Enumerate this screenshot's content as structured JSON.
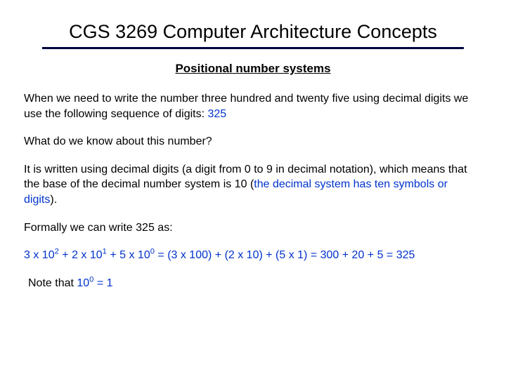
{
  "title": "CGS 3269 Computer Architecture Concepts",
  "subtitle": "Positional number systems",
  "p1a": "When we need to write the number three hundred and twenty  five using decimal digits we use the following sequence of digits: ",
  "p1b": "325",
  "p2": "What do we know about this number?",
  "p3a": "It is written using decimal digits (a digit from 0 to 9 in decimal notation), which means that the base of the decimal number system   is 10 (",
  "p3b": "the decimal system has ten symbols or digits",
  "p3c": ").",
  "p4": "Formally we can write 325 as:",
  "eq": {
    "t1": "3 x 10",
    "e1": "2",
    "t2": " + 2 x 10",
    "e2": "1",
    "t3": " + 5 x 10",
    "e3": "0",
    "t4": " = (3 x 100) + (2 x 10) + (5 x 1) = 300 + 20 + 5 = 325"
  },
  "note_a": "Note that  ",
  "note_b": "10",
  "note_exp": "0",
  "note_c": " = 1"
}
